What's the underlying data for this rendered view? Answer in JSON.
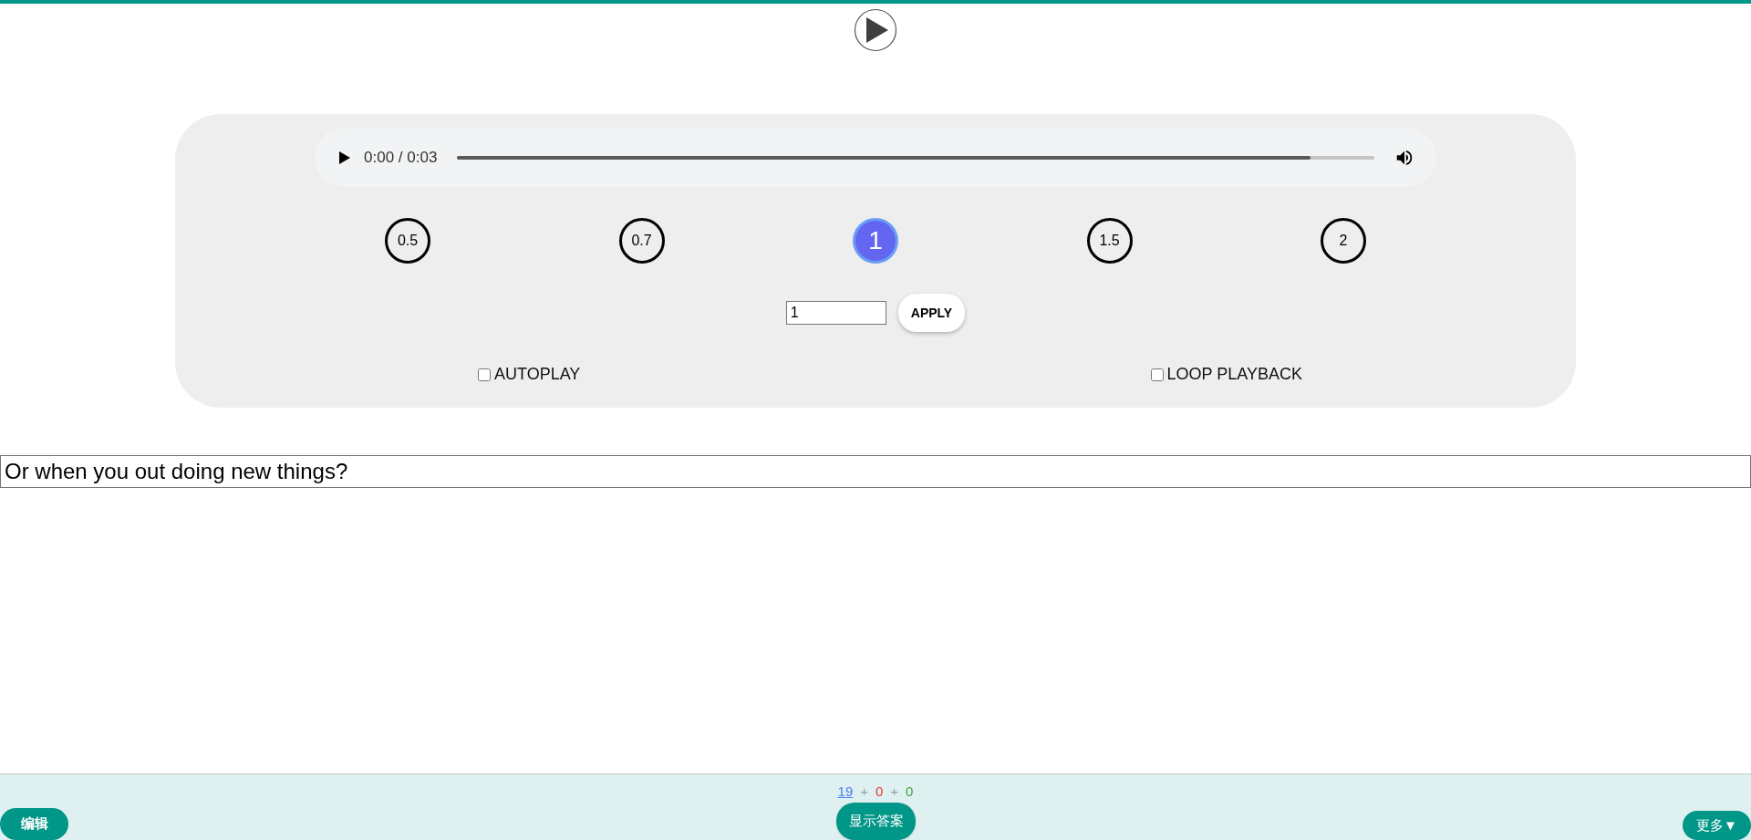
{
  "audio": {
    "time": "0:00 / 0:03",
    "level": 0.93
  },
  "speeds": [
    {
      "label": "0.5",
      "selected": false
    },
    {
      "label": "0.7",
      "selected": false
    },
    {
      "label": "1",
      "selected": true
    },
    {
      "label": "1.5",
      "selected": false
    },
    {
      "label": "2",
      "selected": false
    }
  ],
  "rate_field": {
    "value": "1"
  },
  "apply_button": "APPLY",
  "options": [
    {
      "label": "AUTOPLAY",
      "checked": false
    },
    {
      "label": "LOOP PLAYBACK",
      "checked": false
    }
  ],
  "answer_field": {
    "value": "Or when you out doing new things?"
  },
  "footer": {
    "counts": [
      {
        "text": "19",
        "kind": "link",
        "color": "#4a7cf7"
      },
      {
        "text": "+",
        "kind": "sep",
        "color": "#8fa3a3"
      },
      {
        "text": "0",
        "kind": "num",
        "color": "#e53935"
      },
      {
        "text": "+",
        "kind": "sep",
        "color": "#8fa3a3"
      },
      {
        "text": "0",
        "kind": "num",
        "color": "#43a047"
      }
    ],
    "edit_button": "编辑",
    "show_answer_button": "显示答案",
    "more_button": "更多▼"
  }
}
